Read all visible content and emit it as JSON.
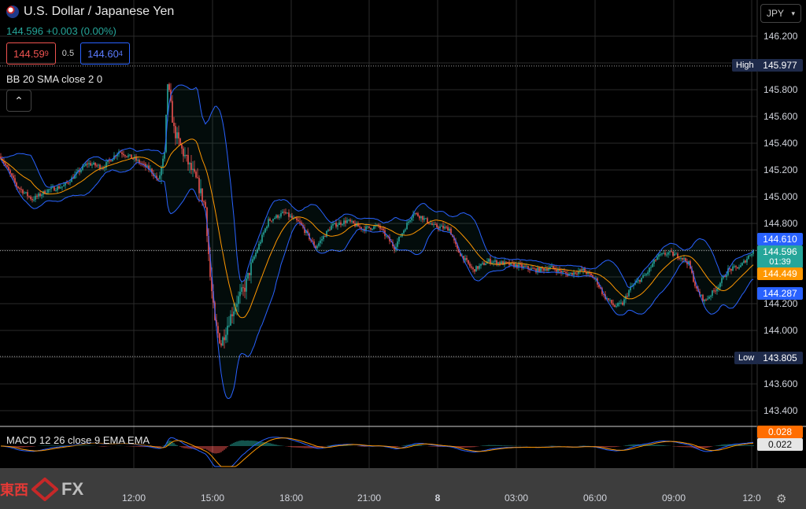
{
  "header": {
    "symbol": "U.S. Dollar / Japanese Yen",
    "last": "144.596",
    "change": "+0.003 (0.00%)",
    "bid": "144.59",
    "bid_sup": "9",
    "spread": "0.5",
    "ask": "144.60",
    "ask_sup": "4",
    "indicator": "BB 20 SMA close 2 0",
    "currency": "JPY"
  },
  "macd_label": "MACD 12 26 close 9 EMA EMA",
  "tags": {
    "high_label": "High",
    "high_value": "145.977",
    "low_label": "Low",
    "low_value": "143.805",
    "bb_upper": "144.610",
    "price": "144.596",
    "countdown": "01:39",
    "bb_mid": "144.449",
    "bb_lower": "144.287",
    "macd_signal": "0.028",
    "macd_value": "0.022"
  },
  "colors": {
    "up": "#26a69a",
    "down": "#ef5350",
    "bb_band": "#2962ff",
    "bb_basis": "#ff9800",
    "macd": "#2962ff",
    "signal": "#ff9800"
  },
  "logo": {
    "cn": "東西",
    "fx": "FX"
  },
  "chart_data": {
    "type": "candlestick",
    "title": "U.S. Dollar / Japanese Yen",
    "y_ticks": [
      146.2,
      146.0,
      145.8,
      145.6,
      145.4,
      145.2,
      145.0,
      144.8,
      144.6,
      144.4,
      144.2,
      144.0,
      143.8,
      143.6,
      143.4
    ],
    "ylim": [
      143.35,
      146.3
    ],
    "x_ticks": [
      "12:00",
      "15:00",
      "18:00",
      "21:00",
      "8",
      "03:00",
      "06:00",
      "09:00",
      "12:0"
    ],
    "anchors": [
      [
        0,
        145.3
      ],
      [
        10,
        145.08
      ],
      [
        20,
        144.98
      ],
      [
        30,
        145.05
      ],
      [
        40,
        145.08
      ],
      [
        55,
        145.25
      ],
      [
        65,
        145.22
      ],
      [
        75,
        145.34
      ],
      [
        85,
        145.28
      ],
      [
        95,
        145.2
      ],
      [
        100,
        145.12
      ],
      [
        104,
        145.3
      ],
      [
        106,
        145.85
      ],
      [
        110,
        145.5
      ],
      [
        115,
        145.35
      ],
      [
        125,
        145.1
      ],
      [
        130,
        144.92
      ],
      [
        133,
        144.4
      ],
      [
        136,
        144.05
      ],
      [
        140,
        143.9
      ],
      [
        145,
        144.08
      ],
      [
        150,
        144.22
      ],
      [
        155,
        144.32
      ],
      [
        160,
        144.52
      ],
      [
        170,
        144.82
      ],
      [
        180,
        144.88
      ],
      [
        190,
        144.8
      ],
      [
        200,
        144.62
      ],
      [
        210,
        144.78
      ],
      [
        220,
        144.82
      ],
      [
        230,
        144.76
      ],
      [
        240,
        144.78
      ],
      [
        250,
        144.62
      ],
      [
        255,
        144.73
      ],
      [
        262,
        144.88
      ],
      [
        267,
        144.85
      ],
      [
        275,
        144.78
      ],
      [
        285,
        144.76
      ],
      [
        290,
        144.6
      ],
      [
        300,
        144.45
      ],
      [
        310,
        144.52
      ],
      [
        320,
        144.5
      ],
      [
        330,
        144.48
      ],
      [
        340,
        144.45
      ],
      [
        350,
        144.47
      ],
      [
        360,
        144.42
      ],
      [
        370,
        144.45
      ],
      [
        378,
        144.38
      ],
      [
        383,
        144.26
      ],
      [
        390,
        144.18
      ],
      [
        395,
        144.2
      ],
      [
        400,
        144.32
      ],
      [
        410,
        144.42
      ],
      [
        417,
        144.55
      ],
      [
        424,
        144.58
      ],
      [
        432,
        144.55
      ],
      [
        437,
        144.5
      ],
      [
        442,
        144.3
      ],
      [
        447,
        144.22
      ],
      [
        455,
        144.32
      ],
      [
        462,
        144.45
      ],
      [
        470,
        144.48
      ],
      [
        478,
        144.6
      ]
    ],
    "candle_count": 479,
    "bollinger": {
      "period": 20,
      "stddev": 2,
      "source": "close"
    },
    "macd": {
      "fast": 12,
      "slow": 26,
      "signal": 9,
      "source": "close"
    }
  }
}
